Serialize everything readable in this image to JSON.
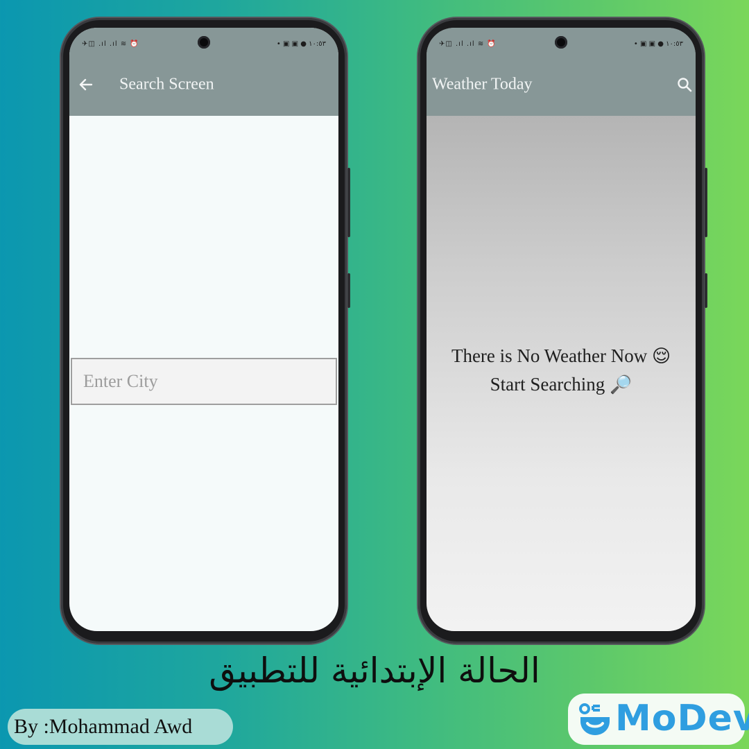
{
  "search_screen": {
    "status_left": "✈◫ .ıl .ıl ≋ ⏰",
    "status_right": "• ▣ ▣ ● ١٠:٥٣",
    "title": "Search Screen",
    "back_icon": "back-arrow-icon",
    "city_input": {
      "placeholder": "Enter City",
      "value": ""
    }
  },
  "weather_screen": {
    "status_left": "✈◫ .ıl .ıl ≋ ⏰",
    "status_right": "• ▣ ▣ ● ١٠:٥٣",
    "title": "Weather Today",
    "search_icon": "search-icon",
    "message_line1": "There is No Weather Now",
    "emoji1": "😌",
    "message_line2": "Start Searching",
    "emoji2": "🔎"
  },
  "caption": "الحالة الإبتدائية للتطبيق",
  "author": "By :Mohammad Awd",
  "brand": {
    "name": "MoDev",
    "color": "#2f9ee0"
  },
  "colors": {
    "appbar": "#879797",
    "background_start": "#0b97b0",
    "background_end": "#7ad75a"
  }
}
